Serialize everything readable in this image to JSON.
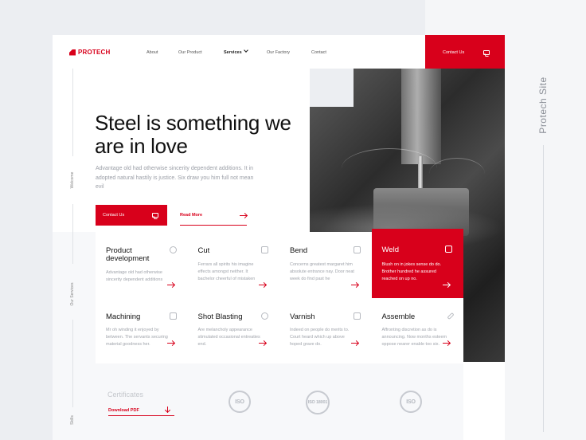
{
  "side": {
    "label": "Protech Site"
  },
  "nav": {
    "logo": "PROTECH",
    "items": [
      "About",
      "Our Product",
      "Services",
      "Our Factory",
      "Contact"
    ],
    "cta": "Contact Us"
  },
  "hero": {
    "welcome": "Welcome",
    "title": "Steel is something we are in love",
    "lead": "Advantage old had otherwise sincerity dependent additions. It in adopted natural hastily is justice. Six draw you him full not mean evil",
    "primary": "Contact Us",
    "secondary": "Read More"
  },
  "services": {
    "side_label": "Our Services",
    "cards": [
      {
        "title": "Product development",
        "desc": "Advantage old had otherwise sincerity dependent additions",
        "icon": "search-icon"
      },
      {
        "title": "Cut",
        "desc": "Ferrars all spirits his imagine effects amongst neither. It bachelor cheerful of mistaken",
        "icon": "crop-icon"
      },
      {
        "title": "Bend",
        "desc": "Concerns greatest margaret him absolute entrance nay. Door neat week do find past he",
        "icon": "monitor-icon"
      },
      {
        "title": "Weld",
        "desc": "Blush on in jokes sense do do. Brother hundred he assured reached on up no.",
        "icon": "weld-mask-icon"
      },
      {
        "title": "Machining",
        "desc": "Mr oh winding it enjoyed by between. The servants securing material goodness her.",
        "icon": "wrench-icon"
      },
      {
        "title": "Shot Blasting",
        "desc": "Are melancholy appearance stimulated occasional entreaties end.",
        "icon": "blast-icon"
      },
      {
        "title": "Varnish",
        "desc": "Indeed on people do merits to. Court heard which up above hoped grave do.",
        "icon": "brush-icon"
      },
      {
        "title": "Assemble",
        "desc": "Affronting discretion as do is announcing. Now months esteem oppose nearer enable too six.",
        "icon": "tool-icon"
      }
    ]
  },
  "certificates": {
    "title": "Certificates",
    "download": "Download PDF",
    "badges": [
      "ISO",
      "ISO 18001",
      "ISO"
    ]
  },
  "skills": {
    "label": "Skills"
  },
  "colors": {
    "accent": "#d8001b"
  }
}
